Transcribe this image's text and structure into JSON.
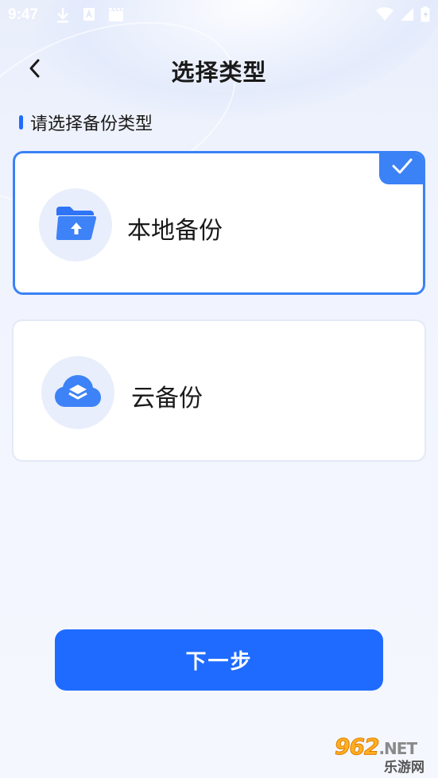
{
  "status_bar": {
    "time": "9:47"
  },
  "header": {
    "title": "选择类型"
  },
  "section": {
    "label": "请选择备份类型"
  },
  "options": [
    {
      "label": "本地备份",
      "icon": "folder-upload-icon",
      "selected": true
    },
    {
      "label": "云备份",
      "icon": "cloud-layers-icon",
      "selected": false
    }
  ],
  "next_button": {
    "label": "下一步"
  },
  "watermark": {
    "top": "962",
    "top_suffix": ".NET",
    "bottom": "乐游网"
  },
  "colors": {
    "accent": "#1f6bff",
    "selected_border": "#3b82f6",
    "icon_bg": "#e8eefb"
  }
}
